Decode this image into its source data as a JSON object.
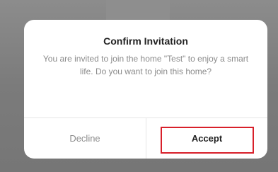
{
  "dialog": {
    "title": "Confirm Invitation",
    "message": "You are invited to join the home \"Test\" to enjoy a smart life. Do you want to join this home?",
    "decline_label": "Decline",
    "accept_label": "Accept"
  },
  "colors": {
    "backdrop": "#7a7a7a",
    "dialog_background": "#ffffff",
    "title_text": "#222222",
    "secondary_text": "#8b8b8b",
    "highlight": "#d8202a"
  }
}
